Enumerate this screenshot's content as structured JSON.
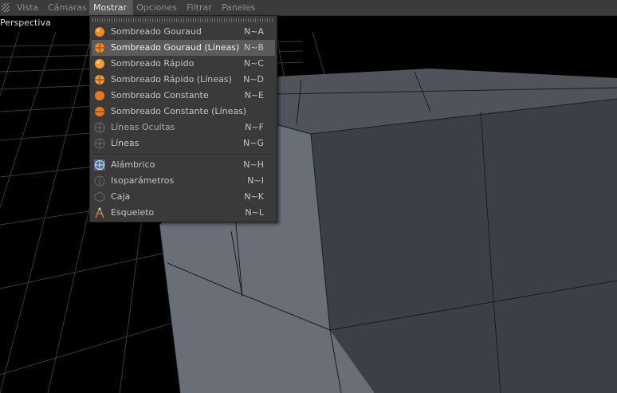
{
  "menubar": {
    "items": [
      {
        "label": "Vista"
      },
      {
        "label": "Cámaras"
      },
      {
        "label": "Mostrar"
      },
      {
        "label": "Opciones"
      },
      {
        "label": "Filtrar"
      },
      {
        "label": "Paneles"
      }
    ],
    "active_index": 2
  },
  "viewport": {
    "label": "Perspectiva"
  },
  "dropdown": {
    "items": [
      {
        "label": "Sombreado Gouraud",
        "shortcut": "N~A",
        "icon": "gouraud-shading-icon"
      },
      {
        "label": "Sombreado Gouraud (Líneas)",
        "shortcut": "N~B",
        "icon": "gouraud-lines-icon",
        "highlighted": true
      },
      {
        "label": "Sombreado Rápido",
        "shortcut": "N~C",
        "icon": "quick-shading-icon"
      },
      {
        "label": "Sombreado Rápido (Líneas)",
        "shortcut": "N~D",
        "icon": "quick-lines-icon"
      },
      {
        "label": "Sombreado Constante",
        "shortcut": "N~E",
        "icon": "constant-shading-icon"
      },
      {
        "label": "Sombreado Constante (Líneas)",
        "shortcut": "",
        "icon": "constant-lines-icon"
      },
      {
        "label": "Líneas Ocultas",
        "shortcut": "N~F",
        "icon": "hidden-lines-icon"
      },
      {
        "label": "Líneas",
        "shortcut": "N~G",
        "icon": "lines-icon"
      },
      {
        "label": "Alámbrico",
        "shortcut": "N~H",
        "icon": "wireframe-icon"
      },
      {
        "label": "Isoparámetros",
        "shortcut": "N~I",
        "icon": "isoparms-icon"
      },
      {
        "label": "Caja",
        "shortcut": "N~K",
        "icon": "box-icon"
      },
      {
        "label": "Esqueleto",
        "shortcut": "N~L",
        "icon": "skeleton-icon"
      }
    ]
  },
  "colors": {
    "menubar_bg": "#3b3b3b",
    "menu_bg": "#3a3a3a",
    "highlight_bg": "#5b5b5b",
    "orange_accent": "#f08a1e",
    "object_face": "#3a3d42"
  }
}
